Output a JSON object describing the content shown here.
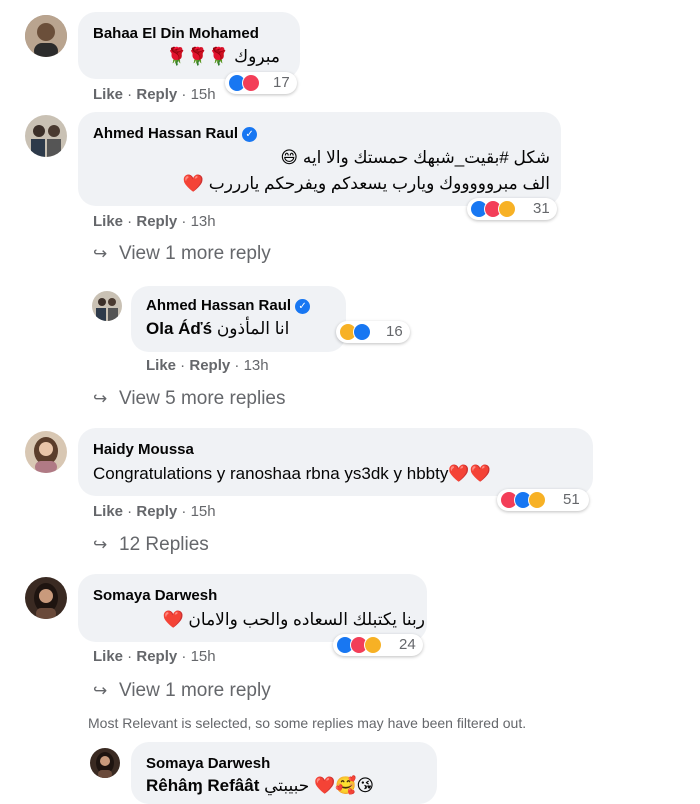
{
  "comments": [
    {
      "author": "Bahaa El Din Mohamed",
      "text": "مبروك 🌹🌹🌹",
      "like": "Like",
      "reply": "Reply",
      "time": "15h",
      "reaction_count": "17"
    },
    {
      "author": "Ahmed Hassan Raul",
      "text_line1": "شكل #بقيت_شبهك حمستك والا ايه 😄",
      "text_line2": "الف مبروووووك ويارب يسعدكم ويفرحكم يارررب ❤️",
      "like": "Like",
      "reply": "Reply",
      "time": "13h",
      "reaction_count": "31",
      "more_replies": "View 1 more reply",
      "reply_item": {
        "author": "Ahmed Hassan Raul",
        "mention": "Ola Áďś",
        "text": "انا المأذون",
        "like": "Like",
        "reply": "Reply",
        "time": "13h",
        "reaction_count": "16"
      },
      "more_replies_2": "View 5 more replies"
    },
    {
      "author": "Haidy Moussa",
      "text": "Congratulations y ranoshaa rbna ys3dk y hbbty❤️❤️",
      "like": "Like",
      "reply": "Reply",
      "time": "15h",
      "reaction_count": "51",
      "more_replies": "12 Replies"
    },
    {
      "author": "Somaya Darwesh",
      "text": "ربنا يكتبلك السعاده والحب والامان ❤️",
      "like": "Like",
      "reply": "Reply",
      "time": "15h",
      "reaction_count": "24",
      "more_replies": "View 1 more reply",
      "filter_note": "Most Relevant is selected, so some replies may have been filtered out.",
      "reply_item": {
        "author": "Somaya Darwesh",
        "mention": "Rêhâɱ Refâât",
        "text": "حبيبتي ❤️🥰😘"
      }
    }
  ],
  "icons": {
    "like": "like-reaction-icon",
    "love": "love-reaction-icon",
    "haha": "haha-reaction-icon",
    "care": "care-reaction-icon",
    "wow": "wow-reaction-icon",
    "reply_arrow": "reply-arrow-icon",
    "verified": "verified-badge-icon"
  },
  "colors": {
    "bubble": "#f0f2f5",
    "secondary_text": "#65676b",
    "like_blue": "#1877f2",
    "love_red": "#f33e58",
    "emoji_yellow": "#f7b125"
  }
}
